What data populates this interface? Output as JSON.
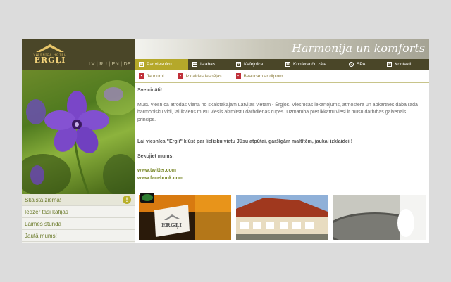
{
  "logo": {
    "sub_text": "VIESNĪCA HOTEL",
    "name": "ĒRGĻI"
  },
  "languages": [
    "LV",
    "RU",
    "EN",
    "DE"
  ],
  "slogan": "Harmonija un komforts",
  "nav": [
    {
      "label": "Par viesnīcu",
      "icon": "hotel-icon",
      "active": true
    },
    {
      "label": "Istabas",
      "icon": "bed-icon",
      "active": false
    },
    {
      "label": "Kafejnīca",
      "icon": "fork-knife-icon",
      "active": false
    },
    {
      "label": "Konferenču zāle",
      "icon": "conference-icon",
      "active": false
    },
    {
      "label": "SPA",
      "icon": "spa-drop-icon",
      "active": false
    },
    {
      "label": "Kontakti",
      "icon": "envelope-icon",
      "active": false
    }
  ],
  "subnav": [
    {
      "label": "Jaunumi",
      "icon": "pdf-icon"
    },
    {
      "label": "Izklaides iespējas",
      "icon": "pdf-icon"
    },
    {
      "label": "Beaucam ar diplom",
      "icon": "pdf-icon"
    }
  ],
  "content": {
    "greeting": "Sveicināti!",
    "paragraph": "Mūsu viesnīca atrodas vienā no skaistākajām Latvijas vietām - Ērgļos. Viesnīcas iekārtojums, atmosfēra un apkārtnes daba rada harmonisku vidi, lai ikviens mūsu viesis aizmirstu darbdienas rūpes. Uzmanība pret ikkatru viesi ir mūsu darbības galvenais princips.",
    "invite": "Lai viesnīca \"Ērgļi\" kļūst par lielisku vietu Jūsu atpūtai, garšīgām maltītēm, jaukai izklaidei !",
    "follow": "Sekojiet mums:",
    "twitter": "www.twitter.com",
    "facebook": "www.facebook.com"
  },
  "side_menu": [
    {
      "label": "Skaistā ziema!",
      "badge": "!"
    },
    {
      "label": "Iedzer tasi kafijas"
    },
    {
      "label": "Laimes stunda"
    },
    {
      "label": "Jautā mums!"
    }
  ],
  "thumb_logo": "ĒRGĻI",
  "colors": {
    "brand_dark": "#4a4628",
    "accent": "#b5a82a",
    "link": "#7b8a2c"
  }
}
